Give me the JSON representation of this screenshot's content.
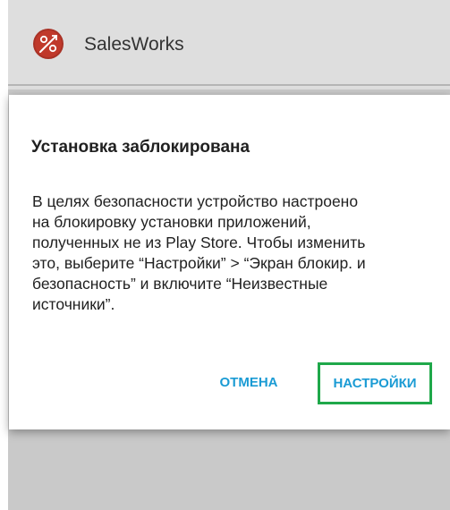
{
  "app": {
    "title": "SalesWorks",
    "icon": "app-logo-icon",
    "icon_color": "#c0392b"
  },
  "dialog": {
    "title": "Установка заблокирована",
    "message_lines": [
      "В целях безопасности устройство настроено",
      "на блокировку установки приложений,",
      "полученных не из Play Store. Чтобы изменить",
      "это, выберите “Настройки” > “Экран блокир. и",
      "безопасность” и включите “Неизвестные",
      "источники”."
    ],
    "buttons": {
      "cancel": "ОТМЕНА",
      "settings": "НАСТРОЙКИ"
    }
  },
  "colors": {
    "accent": "#1a9bd4",
    "highlight_border": "#1fa84a",
    "dim_background": "#c9c9c9"
  }
}
